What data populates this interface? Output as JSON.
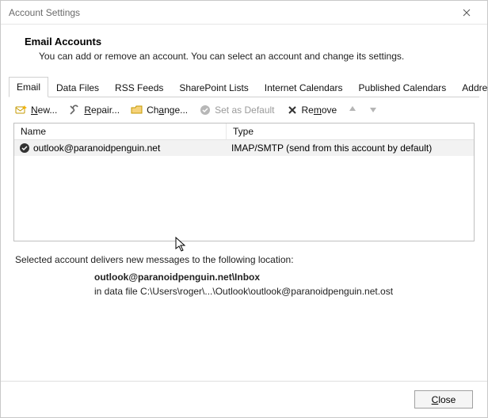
{
  "window": {
    "title": "Account Settings"
  },
  "header": {
    "title": "Email Accounts",
    "subtitle": "You can add or remove an account. You can select an account and change its settings."
  },
  "tabs": [
    {
      "label": "Email"
    },
    {
      "label": "Data Files"
    },
    {
      "label": "RSS Feeds"
    },
    {
      "label": "SharePoint Lists"
    },
    {
      "label": "Internet Calendars"
    },
    {
      "label": "Published Calendars"
    },
    {
      "label": "Address Books"
    }
  ],
  "toolbar": {
    "new": "New...",
    "repair": "Repair...",
    "change": "Change...",
    "set_default": "Set as Default",
    "remove": "Remove"
  },
  "columns": {
    "name": "Name",
    "type": "Type"
  },
  "rows": [
    {
      "name": "outlook@paranoidpenguin.net",
      "type": "IMAP/SMTP (send from this account by default)"
    }
  ],
  "info": {
    "line1": "Selected account delivers new messages to the following location:",
    "location": "outlook@paranoidpenguin.net\\Inbox",
    "path": "in data file C:\\Users\\roger\\...\\Outlook\\outlook@paranoidpenguin.net.ost"
  },
  "buttons": {
    "close": "Close"
  }
}
